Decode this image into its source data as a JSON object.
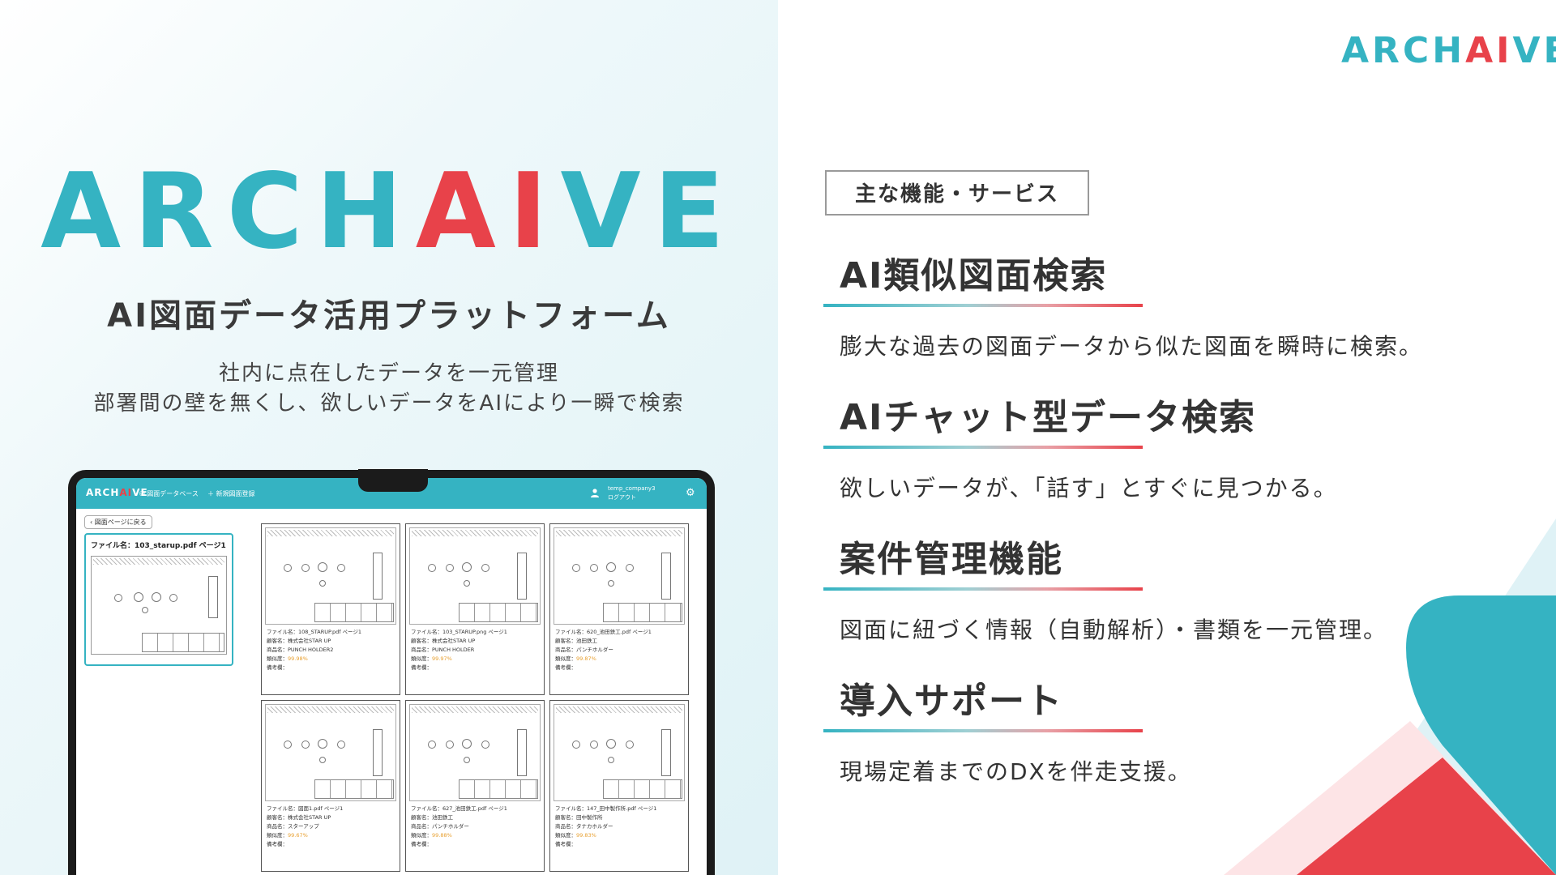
{
  "brand": {
    "part1": "ARCH",
    "part2": "AI",
    "part3": "VE",
    "teal": "#35b3c2",
    "red": "#e8424a"
  },
  "hero": {
    "tagline": "AI図面データ活用プラットフォーム",
    "desc_line1": "社内に点在したデータを一元管理",
    "desc_line2": "部署間の壁を無くし、欲しいデータをAIにより一瞬で検索"
  },
  "app": {
    "nav_items": [
      "図面データベース",
      "＋ 新規図面登録"
    ],
    "user_name": "temp_company3",
    "logout": "ログアウト",
    "back_button": "図面ページに戻る",
    "selected_title": "ファイル名：103_starup.pdf ページ1",
    "cards": [
      {
        "file": "ファイル名：108_STARUP.pdf ページ1",
        "customer": "顧客名：株式会社STAR UP",
        "product": "商品名：PUNCH HOLDER2",
        "similarity": "99.98%",
        "note": "備考欄："
      },
      {
        "file": "ファイル名：103_STARUP.png ページ1",
        "customer": "顧客名：株式会社STAR UP",
        "product": "商品名：PUNCH HOLDER",
        "similarity": "99.97%",
        "note": "備考欄："
      },
      {
        "file": "ファイル名：620_池田鉄工.pdf ページ1",
        "customer": "顧客名：池田鉄工",
        "product": "商品名：パンチホルダー",
        "similarity": "99.87%",
        "note": "備考欄："
      },
      {
        "file": "ファイル名：図面1.pdf ページ1",
        "customer": "顧客名：株式会社STAR UP",
        "product": "商品名：スターアップ",
        "similarity": "99.67%",
        "note": "備考欄："
      },
      {
        "file": "ファイル名：627_池田鉄工.pdf ページ1",
        "customer": "顧客名：池田鉄工",
        "product": "商品名：パンチホルダー",
        "similarity": "99.88%",
        "note": "備考欄："
      },
      {
        "file": "ファイル名：147_田中製作所.pdf ページ1",
        "customer": "顧客名：田中製作所",
        "product": "商品名：タナカホルダー",
        "similarity": "99.83%",
        "note": "備考欄："
      }
    ],
    "similarity_label": "類似度："
  },
  "services": {
    "heading": "主な機能・サービス",
    "items": [
      {
        "title": "AI類似図面検索",
        "desc": "膨大な過去の図面データから似た図面を瞬時に検索。"
      },
      {
        "title": "AIチャット型データ検索",
        "desc": "欲しいデータが、「話す」とすぐに見つかる。"
      },
      {
        "title": "案件管理機能",
        "desc": "図面に紐づく情報（自動解析）・書類を一元管理。"
      },
      {
        "title": "導入サポート",
        "desc": "現場定着までのDXを伴走支援。"
      }
    ]
  }
}
